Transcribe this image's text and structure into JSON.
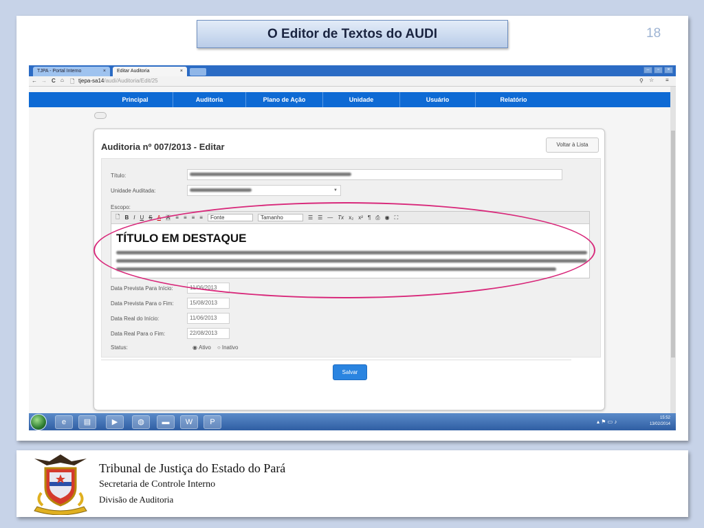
{
  "slide": {
    "title": "O Editor de Textos do AUDI",
    "page_number": "18"
  },
  "browser": {
    "tabs": [
      {
        "label": "TJPA - Portal Interno",
        "close": "×"
      },
      {
        "label": "Editar Auditoria",
        "close": "×"
      }
    ],
    "address": {
      "host": "tjepa-sa14",
      "path": "/audi/Auditoria/Edit/25"
    },
    "nav": {
      "back": "←",
      "forward": "→",
      "reload": "C",
      "home": "⌂",
      "page": "🗋",
      "zoom": "⚲",
      "star": "☆",
      "menu": "≡"
    }
  },
  "menu": [
    "Principal",
    "Auditoria",
    "Plano de Ação",
    "Unidade",
    "Usuário",
    "Relatório"
  ],
  "form": {
    "title": "Auditoria nº 007/2013 - Editar",
    "back_label": "Voltar à Lista",
    "titulo_label": "Título:",
    "unidade_label": "Unidade Auditada:",
    "escopo_label": "Escopo:",
    "toolbar": {
      "font_label": "Fonte",
      "size_label": "Tamanho",
      "buttons": [
        "🗋",
        "B",
        "I",
        "U",
        "S",
        "A",
        "A",
        "≡",
        "≡",
        "≡",
        "≡"
      ],
      "right_buttons": [
        "☰",
        "☰",
        "—",
        "Tx",
        "x₂",
        "x²",
        "¶",
        "⎙",
        "◉",
        "⛶"
      ]
    },
    "editor_heading": "TÍTULO EM DESTAQUE",
    "dates": [
      {
        "label": "Data Prevista Para Início:",
        "value": "11/06/2013"
      },
      {
        "label": "Data Prevista Para o Fim:",
        "value": "15/08/2013"
      },
      {
        "label": "Data Real do Início:",
        "value": "11/06/2013"
      },
      {
        "label": "Data Real Para o Fim:",
        "value": "22/08/2013"
      }
    ],
    "status_label": "Status:",
    "status_options": [
      "Ativo",
      "Inativo"
    ],
    "status_selected": "Ativo",
    "save_label": "Salvar"
  },
  "taskbar": {
    "time": "15:52",
    "date": "13/02/2014"
  },
  "footer": {
    "line1": "Tribunal de Justiça do Estado do  Pará",
    "line2": "Secretaria de Controle Interno",
    "line3": "Divisão de Auditoria"
  },
  "colors": {
    "nav_blue": "#0e6ad4",
    "highlight_oval": "#d8287a",
    "save_button": "#2a84e0"
  }
}
